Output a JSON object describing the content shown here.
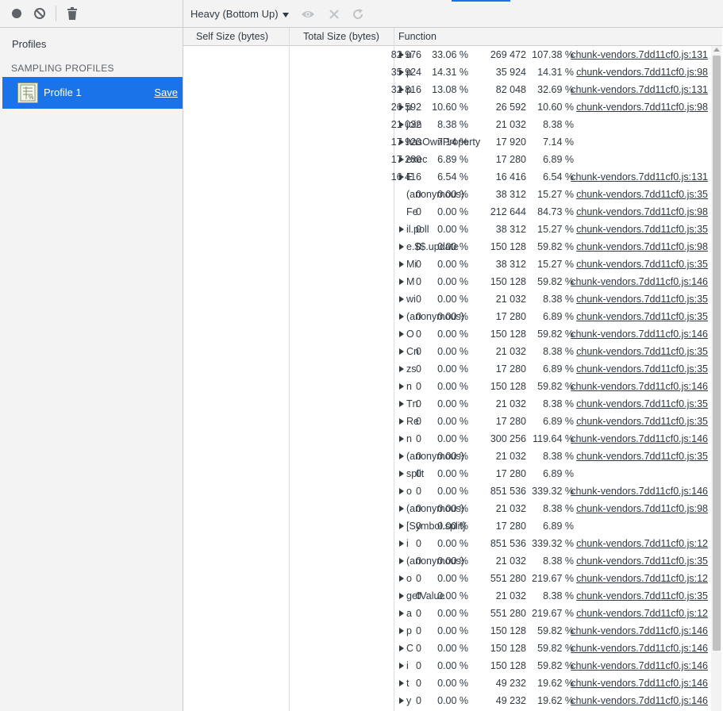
{
  "sidebar": {
    "profiles_heading": "Profiles",
    "sampling_heading": "SAMPLING PROFILES",
    "profile_name": "Profile 1",
    "save_label": "Save"
  },
  "toolbar": {
    "view_mode": "Heavy (Bottom Up)",
    "icons": [
      "record-icon",
      "clear-icon",
      "garbage-collect-icon",
      "focus-eye-icon",
      "exclude-icon",
      "restore-icon"
    ]
  },
  "columns": {
    "self": "Self Size (bytes)",
    "total": "Total Size (bytes)",
    "function": "Function"
  },
  "colors": {
    "accent": "#1a73e8",
    "panel_bg": "#f3f3f3",
    "border": "#cbcdd1"
  },
  "rows": [
    {
      "self": "82 976",
      "self_pct": "33.06 %",
      "total": "269 472",
      "total_pct": "107.38 %",
      "expand": true,
      "fn": "u",
      "url": "chunk-vendors.7dd11cf0.js:131"
    },
    {
      "self": "35 924",
      "self_pct": "14.31 %",
      "total": "35 924",
      "total_pct": "14.31 %",
      "expand": true,
      "fn": "p",
      "url": "chunk-vendors.7dd11cf0.js:98"
    },
    {
      "self": "32 816",
      "self_pct": "13.08 %",
      "total": "82 048",
      "total_pct": "32.69 %",
      "expand": true,
      "fn": "p",
      "url": "chunk-vendors.7dd11cf0.js:131"
    },
    {
      "self": "26 592",
      "self_pct": "10.60 %",
      "total": "26 592",
      "total_pct": "10.60 %",
      "expand": true,
      "fn": "p",
      "url": "chunk-vendors.7dd11cf0.js:98"
    },
    {
      "self": "21 032",
      "self_pct": "8.38 %",
      "total": "21 032",
      "total_pct": "8.38 %",
      "expand": true,
      "fn": "join",
      "url": ""
    },
    {
      "self": "17 920",
      "self_pct": "7.14 %",
      "total": "17 920",
      "total_pct": "7.14 %",
      "expand": true,
      "fn": "hasOwnProperty",
      "url": ""
    },
    {
      "self": "17 280",
      "self_pct": "6.89 %",
      "total": "17 280",
      "total_pct": "6.89 %",
      "expand": true,
      "fn": "exec",
      "url": ""
    },
    {
      "self": "16 416",
      "self_pct": "6.54 %",
      "total": "16 416",
      "total_pct": "6.54 %",
      "expand": true,
      "fn": "E",
      "url": "chunk-vendors.7dd11cf0.js:131"
    },
    {
      "self": "0",
      "self_pct": "0.00 %",
      "total": "38 312",
      "total_pct": "15.27 %",
      "expand": false,
      "fn": "(anonymous)",
      "url": "chunk-vendors.7dd11cf0.js:35"
    },
    {
      "self": "0",
      "self_pct": "0.00 %",
      "total": "212 644",
      "total_pct": "84.73 %",
      "expand": false,
      "fn": "Fe",
      "url": "chunk-vendors.7dd11cf0.js:98"
    },
    {
      "self": "0",
      "self_pct": "0.00 %",
      "total": "38 312",
      "total_pct": "15.27 %",
      "expand": true,
      "fn": "il.poll",
      "url": "chunk-vendors.7dd11cf0.js:35"
    },
    {
      "self": "0",
      "self_pct": "0.00 %",
      "total": "150 128",
      "total_pct": "59.82 %",
      "expand": true,
      "fn": "e.$$.update",
      "url": "chunk-vendors.7dd11cf0.js:98"
    },
    {
      "self": "0",
      "self_pct": "0.00 %",
      "total": "38 312",
      "total_pct": "15.27 %",
      "expand": true,
      "fn": "Mi",
      "url": "chunk-vendors.7dd11cf0.js:35"
    },
    {
      "self": "0",
      "self_pct": "0.00 %",
      "total": "150 128",
      "total_pct": "59.82 %",
      "expand": true,
      "fn": "M",
      "url": "chunk-vendors.7dd11cf0.js:146"
    },
    {
      "self": "0",
      "self_pct": "0.00 %",
      "total": "21 032",
      "total_pct": "8.38 %",
      "expand": true,
      "fn": "wi",
      "url": "chunk-vendors.7dd11cf0.js:35"
    },
    {
      "self": "0",
      "self_pct": "0.00 %",
      "total": "17 280",
      "total_pct": "6.89 %",
      "expand": true,
      "fn": "(anonymous)",
      "url": "chunk-vendors.7dd11cf0.js:35"
    },
    {
      "self": "0",
      "self_pct": "0.00 %",
      "total": "150 128",
      "total_pct": "59.82 %",
      "expand": true,
      "fn": "O",
      "url": "chunk-vendors.7dd11cf0.js:146"
    },
    {
      "self": "0",
      "self_pct": "0.00 %",
      "total": "21 032",
      "total_pct": "8.38 %",
      "expand": true,
      "fn": "Cn",
      "url": "chunk-vendors.7dd11cf0.js:35"
    },
    {
      "self": "0",
      "self_pct": "0.00 %",
      "total": "17 280",
      "total_pct": "6.89 %",
      "expand": true,
      "fn": "zs",
      "url": "chunk-vendors.7dd11cf0.js:35"
    },
    {
      "self": "0",
      "self_pct": "0.00 %",
      "total": "150 128",
      "total_pct": "59.82 %",
      "expand": true,
      "fn": "n",
      "url": "chunk-vendors.7dd11cf0.js:146"
    },
    {
      "self": "0",
      "self_pct": "0.00 %",
      "total": "21 032",
      "total_pct": "8.38 %",
      "expand": true,
      "fn": "Tn",
      "url": "chunk-vendors.7dd11cf0.js:35"
    },
    {
      "self": "0",
      "self_pct": "0.00 %",
      "total": "17 280",
      "total_pct": "6.89 %",
      "expand": true,
      "fn": "Re",
      "url": "chunk-vendors.7dd11cf0.js:35"
    },
    {
      "self": "0",
      "self_pct": "0.00 %",
      "total": "300 256",
      "total_pct": "119.64 %",
      "expand": true,
      "fn": "n",
      "url": "chunk-vendors.7dd11cf0.js:146"
    },
    {
      "self": "0",
      "self_pct": "0.00 %",
      "total": "21 032",
      "total_pct": "8.38 %",
      "expand": true,
      "fn": "(anonymous)",
      "url": "chunk-vendors.7dd11cf0.js:35"
    },
    {
      "self": "0",
      "self_pct": "0.00 %",
      "total": "17 280",
      "total_pct": "6.89 %",
      "expand": true,
      "fn": "split",
      "url": ""
    },
    {
      "self": "0",
      "self_pct": "0.00 %",
      "total": "851 536",
      "total_pct": "339.32 %",
      "expand": true,
      "fn": "o",
      "url": "chunk-vendors.7dd11cf0.js:146"
    },
    {
      "self": "0",
      "self_pct": "0.00 %",
      "total": "21 032",
      "total_pct": "8.38 %",
      "expand": true,
      "fn": "(anonymous)",
      "url": "chunk-vendors.7dd11cf0.js:98"
    },
    {
      "self": "0",
      "self_pct": "0.00 %",
      "total": "17 280",
      "total_pct": "6.89 %",
      "expand": true,
      "fn": "[Symbol.split]",
      "url": ""
    },
    {
      "self": "0",
      "self_pct": "0.00 %",
      "total": "851 536",
      "total_pct": "339.32 %",
      "expand": true,
      "fn": "i",
      "url": "chunk-vendors.7dd11cf0.js:12"
    },
    {
      "self": "0",
      "self_pct": "0.00 %",
      "total": "21 032",
      "total_pct": "8.38 %",
      "expand": true,
      "fn": "(anonymous)",
      "url": "chunk-vendors.7dd11cf0.js:35"
    },
    {
      "self": "0",
      "self_pct": "0.00 %",
      "total": "551 280",
      "total_pct": "219.67 %",
      "expand": true,
      "fn": "o",
      "url": "chunk-vendors.7dd11cf0.js:12"
    },
    {
      "self": "0",
      "self_pct": "0.00 %",
      "total": "21 032",
      "total_pct": "8.38 %",
      "expand": true,
      "fn": "getValue",
      "url": "chunk-vendors.7dd11cf0.js:35"
    },
    {
      "self": "0",
      "self_pct": "0.00 %",
      "total": "551 280",
      "total_pct": "219.67 %",
      "expand": true,
      "fn": "a",
      "url": "chunk-vendors.7dd11cf0.js:12"
    },
    {
      "self": "0",
      "self_pct": "0.00 %",
      "total": "150 128",
      "total_pct": "59.82 %",
      "expand": true,
      "fn": "p",
      "url": "chunk-vendors.7dd11cf0.js:146"
    },
    {
      "self": "0",
      "self_pct": "0.00 %",
      "total": "150 128",
      "total_pct": "59.82 %",
      "expand": true,
      "fn": "C",
      "url": "chunk-vendors.7dd11cf0.js:146"
    },
    {
      "self": "0",
      "self_pct": "0.00 %",
      "total": "150 128",
      "total_pct": "59.82 %",
      "expand": true,
      "fn": "i",
      "url": "chunk-vendors.7dd11cf0.js:146"
    },
    {
      "self": "0",
      "self_pct": "0.00 %",
      "total": "49 232",
      "total_pct": "19.62 %",
      "expand": true,
      "fn": "t",
      "url": "chunk-vendors.7dd11cf0.js:146"
    },
    {
      "self": "0",
      "self_pct": "0.00 %",
      "total": "49 232",
      "total_pct": "19.62 %",
      "expand": true,
      "fn": "y",
      "url": "chunk-vendors.7dd11cf0.js:146"
    }
  ]
}
